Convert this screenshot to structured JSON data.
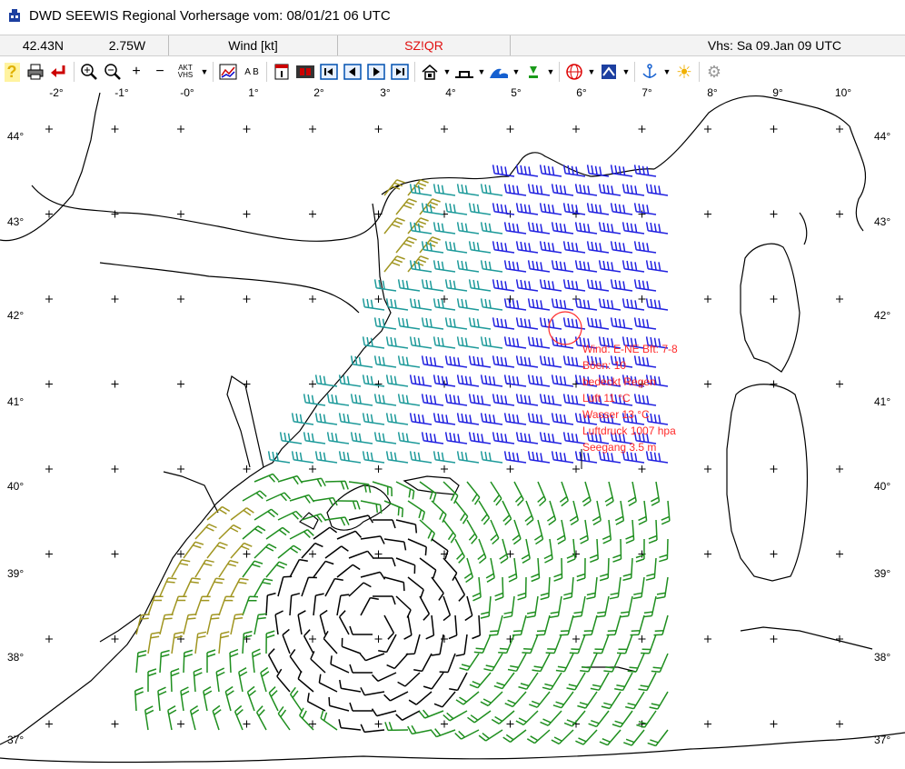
{
  "window": {
    "title": "DWD SEEWIS Regional Vorhersage vom: 08/01/21 06 UTC"
  },
  "status": {
    "lat": "42.43N",
    "lon": "2.75W",
    "mode": "Wind [kt]",
    "code": "SZ!QR",
    "valid": "Vhs: Sa 09.Jan 09 UTC"
  },
  "toolbar": {
    "aktvhs": "AKT VHS",
    "ab": "A B",
    "icons": [
      "help-icon",
      "print-icon",
      "exit-icon",
      "zoom-in-icon",
      "zoom-out-icon",
      "plus-icon",
      "minus-icon",
      "chart-icon",
      "calendar-icon",
      "film-icon",
      "first-frame-icon",
      "prev-frame-icon",
      "next-frame-icon",
      "last-frame-icon",
      "home-icon",
      "baseline-icon",
      "wave-icon",
      "arrow-down-icon",
      "globe-icon",
      "flag-icon",
      "anchor-icon",
      "sun-icon",
      "settings-icon"
    ]
  },
  "map": {
    "lon_labels": [
      "-2°",
      "-1°",
      "-0°",
      "1°",
      "2°",
      "3°",
      "4°",
      "5°",
      "6°",
      "7°",
      "8°",
      "9°",
      "10°"
    ],
    "lat_labels": [
      "44°",
      "43°",
      "42°",
      "41°",
      "40°",
      "39°",
      "38°",
      "37°"
    ],
    "popup": {
      "lines": [
        "Wind: E-NE Bft: 7-8",
        "Böen: 10",
        "bedeckt  Regen",
        "Luft 11 °C",
        "Wasser 13 °C",
        "Luftdruck 1007 hpa",
        "Seegang 3.5 m"
      ]
    },
    "colors": {
      "calm": "#000000",
      "green": "#1f8f1f",
      "olive": "#a09520",
      "teal": "#1d9a9a",
      "blue": "#2020e0",
      "popup": "#ff2a2a"
    }
  }
}
